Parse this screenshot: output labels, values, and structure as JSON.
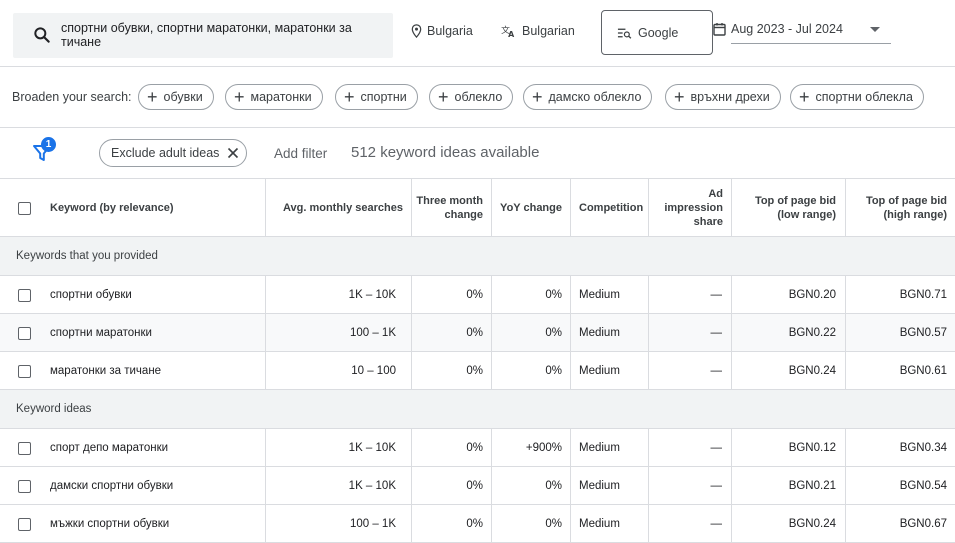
{
  "search": {
    "query": "спортни обувки, спортни маратонки, маратонки за тичане",
    "location": "Bulgaria",
    "language": "Bulgarian",
    "network": "Google",
    "date_range": "Aug 2023 - Jul 2024"
  },
  "broaden": {
    "label": "Broaden your search:",
    "chips": [
      "обувки",
      "маратонки",
      "спортни",
      "облекло",
      "дамско облекло",
      "връхни дрехи",
      "спортни облекла"
    ]
  },
  "filters": {
    "badge": "1",
    "exclude_chip": "Exclude adult ideas",
    "add_filter": "Add filter",
    "count": "512 keyword ideas available"
  },
  "table": {
    "columns": {
      "keyword": "Keyword (by relevance)",
      "avg": "Avg. monthly searches",
      "three_month": "Three month change",
      "yoy": "YoY change",
      "competition": "Competition",
      "ad_share": "Ad impression share",
      "bid_low": "Top of page bid (low range)",
      "bid_high": "Top of page bid (high range)"
    },
    "group_provided": "Keywords that you provided",
    "group_ideas": "Keyword ideas",
    "provided": [
      {
        "keyword": "спортни обувки",
        "avg": "1K – 10K",
        "three_month": "0%",
        "yoy": "0%",
        "competition": "Medium",
        "ad_share": "—",
        "bid_low": "BGN0.20",
        "bid_high": "BGN0.71"
      },
      {
        "keyword": "спортни маратонки",
        "avg": "100 – 1K",
        "three_month": "0%",
        "yoy": "0%",
        "competition": "Medium",
        "ad_share": "—",
        "bid_low": "BGN0.22",
        "bid_high": "BGN0.57"
      },
      {
        "keyword": "маратонки за тичане",
        "avg": "10 – 100",
        "three_month": "0%",
        "yoy": "0%",
        "competition": "Medium",
        "ad_share": "—",
        "bid_low": "BGN0.24",
        "bid_high": "BGN0.61"
      }
    ],
    "ideas": [
      {
        "keyword": "спорт депо маратонки",
        "avg": "1K – 10K",
        "three_month": "0%",
        "yoy": "+900%",
        "competition": "Medium",
        "ad_share": "—",
        "bid_low": "BGN0.12",
        "bid_high": "BGN0.34"
      },
      {
        "keyword": "дамски спортни обувки",
        "avg": "1K – 10K",
        "three_month": "0%",
        "yoy": "0%",
        "competition": "Medium",
        "ad_share": "—",
        "bid_low": "BGN0.21",
        "bid_high": "BGN0.54"
      },
      {
        "keyword": "мъжки спортни обувки",
        "avg": "100 – 1K",
        "three_month": "0%",
        "yoy": "0%",
        "competition": "Medium",
        "ad_share": "—",
        "bid_low": "BGN0.24",
        "bid_high": "BGN0.67"
      }
    ]
  }
}
